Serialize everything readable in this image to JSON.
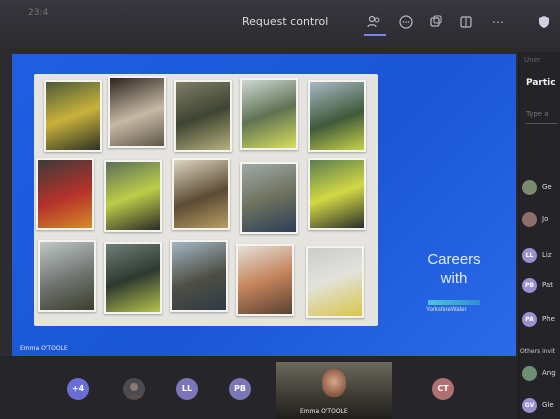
{
  "header": {
    "clock": "23:4",
    "request_control": "Request control",
    "icons": [
      "people-icon",
      "chat-icon",
      "reactions-icon",
      "rooms-icon",
      "more-icon",
      "shield-icon"
    ]
  },
  "screen": {
    "careers_text": "Careers",
    "with_text": "with",
    "logo_text": "YorkshireWater",
    "presenter": "Emma O'TOOLE"
  },
  "panel": {
    "blur": "Uner",
    "title": "Partic",
    "type_placeholder": "Type a",
    "participants": [
      {
        "initials": "",
        "name": "Ge",
        "color": "#7a8b6e"
      },
      {
        "initials": "",
        "name": "Jo",
        "color": "#8e6e6a"
      },
      {
        "initials": "LL",
        "name": "Liz",
        "color": "#9b8fd0"
      },
      {
        "initials": "PB",
        "name": "Pat",
        "color": "#9b8fd0"
      },
      {
        "initials": "PA",
        "name": "Phe",
        "color": "#9b8fd0"
      }
    ],
    "others": "Others invit",
    "invited": [
      {
        "initials": "",
        "name": "Ang",
        "color": "#6f8f74"
      },
      {
        "initials": "GV",
        "name": "Gle",
        "color": "#9b8fd0"
      }
    ]
  },
  "bottom": {
    "more_count": "+4",
    "avatars": [
      "LL",
      "PB",
      "CT"
    ],
    "video_name": "Emma O'TOOLE"
  }
}
